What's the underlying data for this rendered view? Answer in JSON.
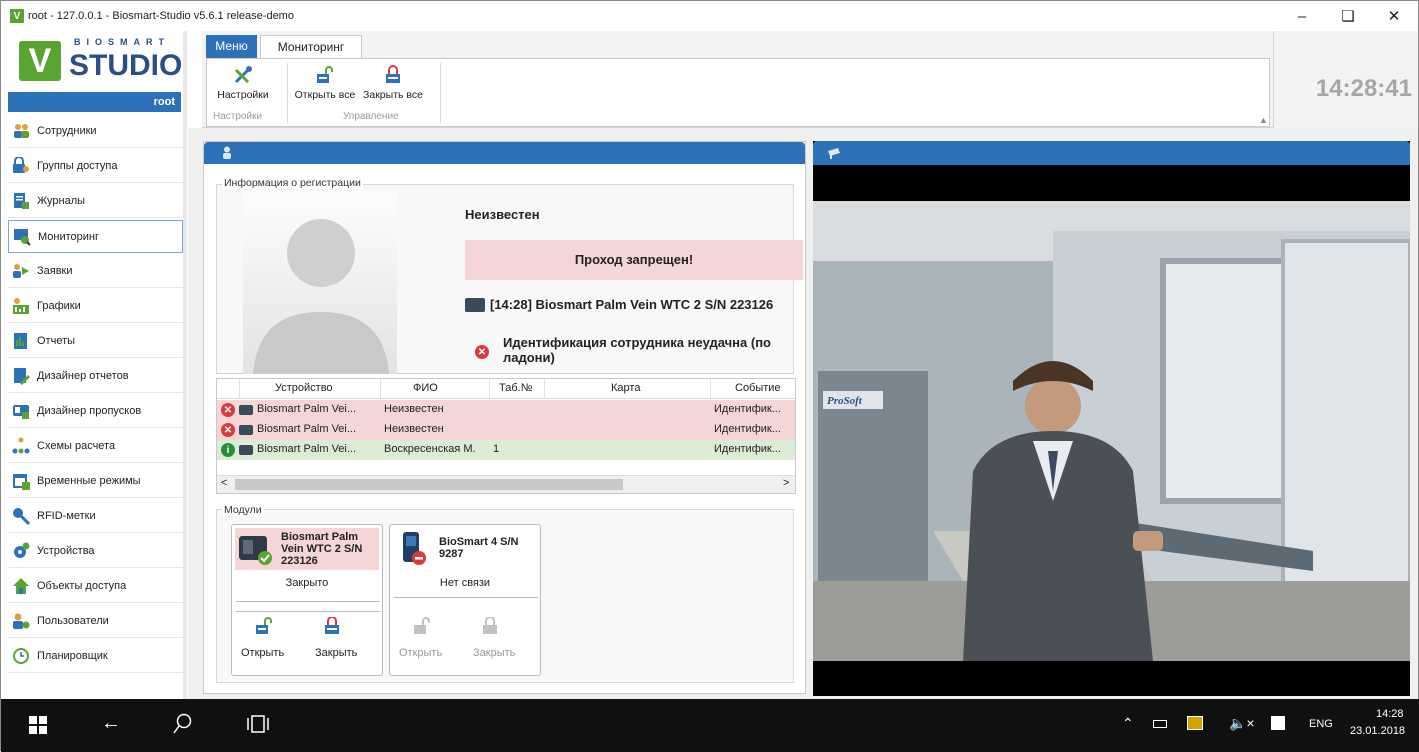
{
  "window": {
    "title": "root - 127.0.0.1 - Biosmart-Studio v5.6.1 release-demo"
  },
  "logo": {
    "top": "BIOSMART",
    "main": "STUDIO"
  },
  "user": "root",
  "sidebar": {
    "items": [
      {
        "label": "Сотрудники"
      },
      {
        "label": "Группы доступа"
      },
      {
        "label": "Журналы"
      },
      {
        "label": "Мониторинг"
      },
      {
        "label": "Заявки"
      },
      {
        "label": "Графики"
      },
      {
        "label": "Отчеты"
      },
      {
        "label": "Дизайнер отчетов"
      },
      {
        "label": "Дизайнер пропусков"
      },
      {
        "label": "Схемы расчета"
      },
      {
        "label": "Временные режимы"
      },
      {
        "label": "RFID-метки"
      },
      {
        "label": "Устройства"
      },
      {
        "label": "Объекты доступа"
      },
      {
        "label": "Пользователи"
      },
      {
        "label": "Планировщик"
      }
    ]
  },
  "ribbon": {
    "tabs": [
      "Меню",
      "Мониторинг"
    ],
    "settings": "Настройки",
    "open_all": "Открыть все",
    "close_all": "Закрыть все",
    "group_settings": "Настройки",
    "group_control": "Управление"
  },
  "clock": "14:28:41",
  "registration": {
    "legend": "Информация о регистрации",
    "name": "Неизвестен",
    "status": "Проход запрещен!",
    "device": "[14:28] Biosmart Palm Vein WTC 2 S/N 223126",
    "message": "Идентификация сотрудника неудачна (по ладони)"
  },
  "events": {
    "columns": [
      "Устройство",
      "ФИО",
      "Таб.№",
      "Карта",
      "Событие"
    ],
    "rows": [
      {
        "device": "Biosmart Palm Vei...",
        "name": "Неизвестен",
        "tab": "",
        "card": "",
        "event": "Идентифик...",
        "status": "error"
      },
      {
        "device": "Biosmart Palm Vei...",
        "name": "Неизвестен",
        "tab": "",
        "card": "",
        "event": "Идентифик...",
        "status": "error"
      },
      {
        "device": "Biosmart Palm Vei...",
        "name": "Воскресенская М.",
        "tab": "1",
        "card": "",
        "event": "Идентифик...",
        "status": "ok"
      }
    ]
  },
  "modules": {
    "legend": "Модули",
    "cards": [
      {
        "title": "Biosmart Palm Vein WTC 2 S/N 223126",
        "state": "Закрыто",
        "open": "Открыть",
        "close": "Закрыть"
      },
      {
        "title": "BioSmart 4 S/N 9287",
        "state": "Нет связи",
        "open": "Открыть",
        "close": "Закрыть"
      }
    ]
  },
  "camera": {
    "brand": "ProSoft"
  },
  "taskbar": {
    "lang": "ENG",
    "time": "14:28",
    "date": "23.01.2018"
  },
  "colors": {
    "accent": "#2d72b8",
    "brand_green": "#5aa532",
    "denied_bg": "#f5d6d6",
    "ok_row": "#dcebd6",
    "error_row": "#f5d6d6"
  }
}
